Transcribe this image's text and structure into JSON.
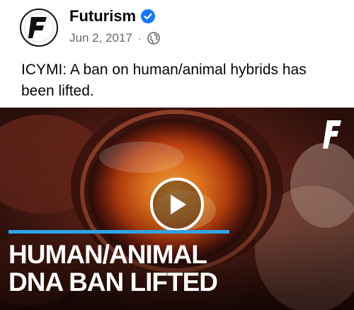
{
  "post": {
    "page_name": "Futurism",
    "avatar_letter": "F",
    "date": "Jun 2, 2017",
    "separator": "·",
    "privacy_icon": "globe-icon",
    "verified_icon": "verified-badge-icon",
    "caption": "ICYMI: A ban on human/animal hybrids has been lifted."
  },
  "video": {
    "brand_letter": "F",
    "play_icon": "play-icon",
    "headline_line1": "HUMAN/ANIMAL",
    "headline_line2": "DNA BAN LIFTED"
  },
  "colors": {
    "verified_blue": "#1877f2",
    "accent_line": "#2fa4e7",
    "meta_gray": "#65676b",
    "text": "#050505"
  }
}
